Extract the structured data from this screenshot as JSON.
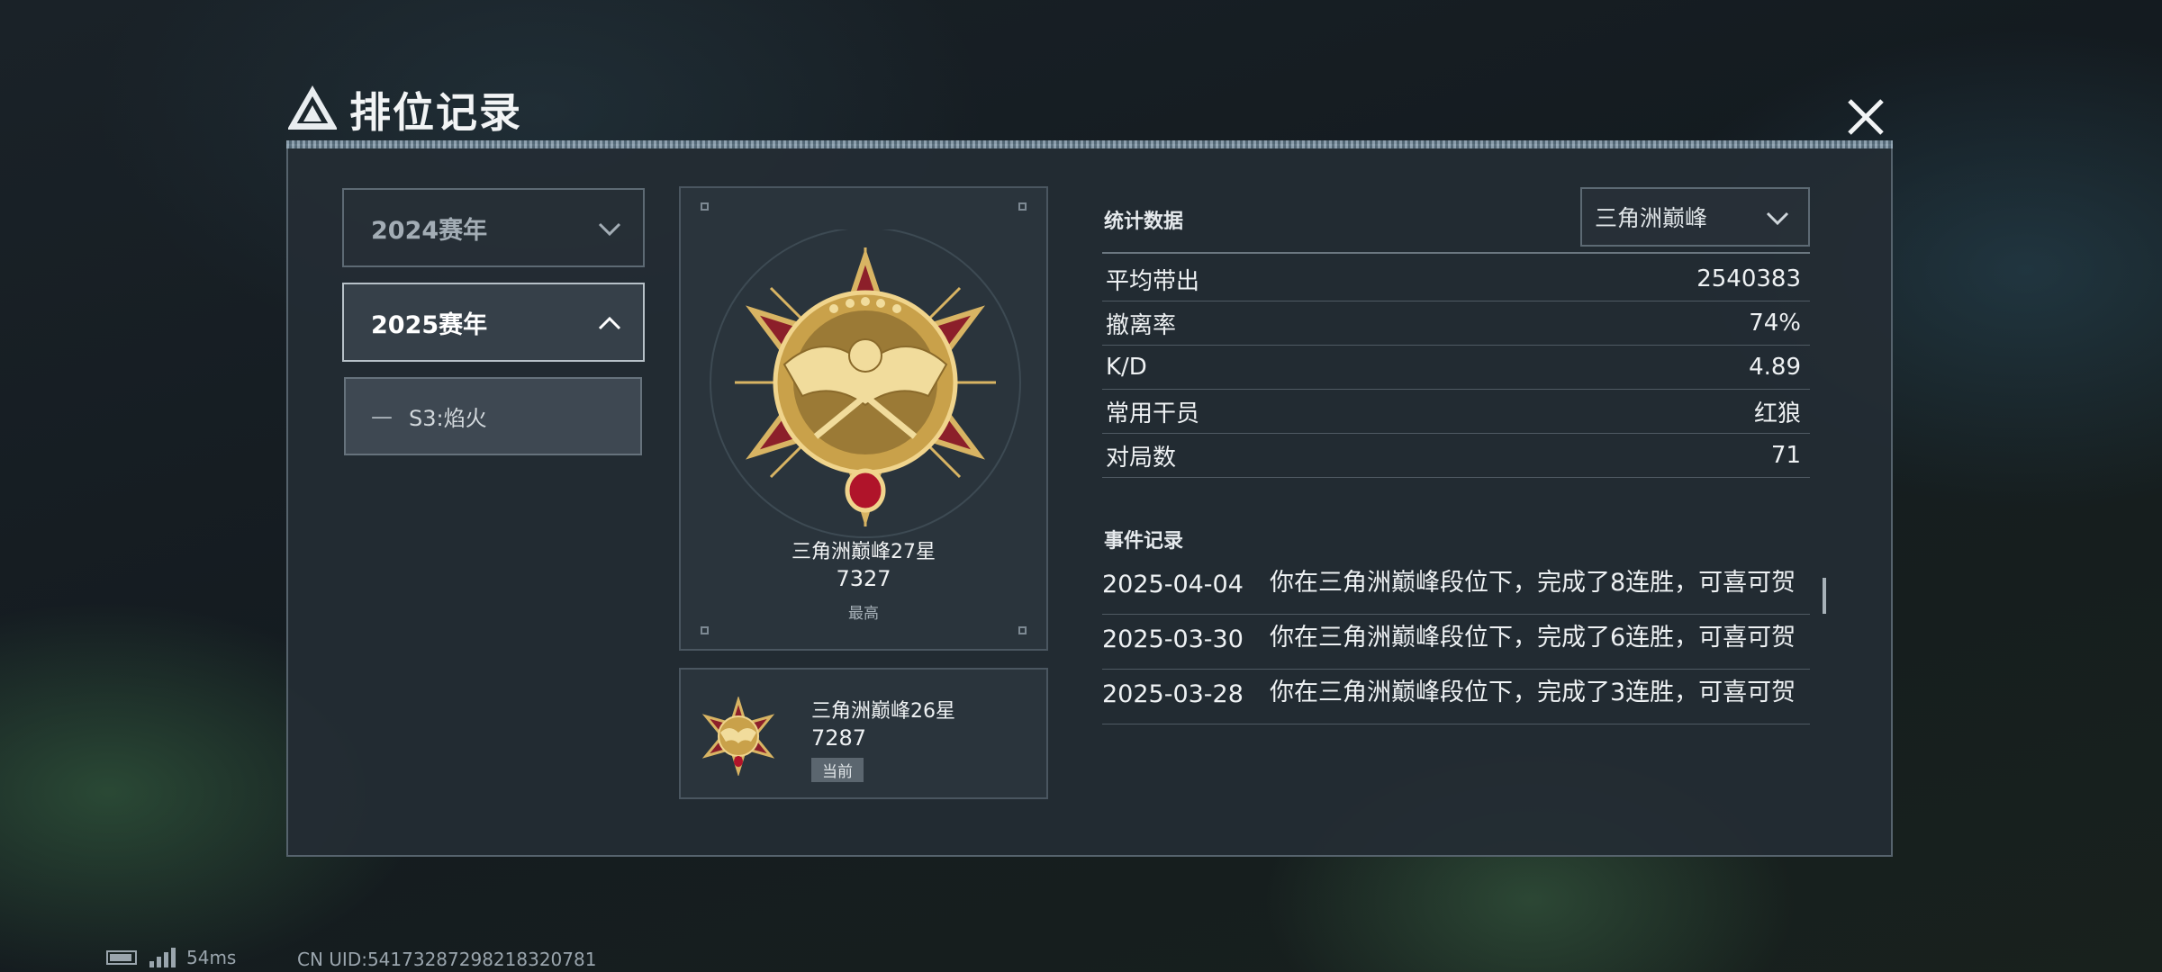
{
  "window": {
    "title": "排位记录"
  },
  "seasons": [
    {
      "label": "2024赛年",
      "expanded": false
    },
    {
      "label": "2025赛年",
      "expanded": true
    }
  ],
  "sub_seasons": [
    {
      "dash": "—",
      "label": "S3:焰火"
    }
  ],
  "best_rank": {
    "name": "三角洲巅峰27星",
    "score": "7327",
    "tag": "最高"
  },
  "current_rank": {
    "name": "三角洲巅峰26星",
    "score": "7287",
    "tag": "当前"
  },
  "stats": {
    "heading": "统计数据",
    "mode_selected": "三角洲巅峰",
    "rows": [
      {
        "label": "平均带出",
        "value": "2540383"
      },
      {
        "label": "撤离率",
        "value": "74%"
      },
      {
        "label": "K/D",
        "value": "4.89"
      },
      {
        "label": "常用干员",
        "value": "红狼"
      },
      {
        "label": "对局数",
        "value": "71"
      }
    ]
  },
  "events": {
    "heading": "事件记录",
    "items": [
      {
        "date": "2025-04-04",
        "text": "你在三角洲巅峰段位下，完成了8连胜，可喜可贺"
      },
      {
        "date": "2025-03-30",
        "text": "你在三角洲巅峰段位下，完成了6连胜，可喜可贺"
      },
      {
        "date": "2025-03-28",
        "text": "你在三角洲巅峰段位下，完成了3连胜，可喜可贺"
      }
    ]
  },
  "status": {
    "ping": "54ms",
    "uid": "CN UID:54173287298218320781"
  },
  "colors": {
    "medal_gold": "#c9a14a",
    "medal_red": "#8c1f2a",
    "accent_line": "#9fb3c2"
  }
}
